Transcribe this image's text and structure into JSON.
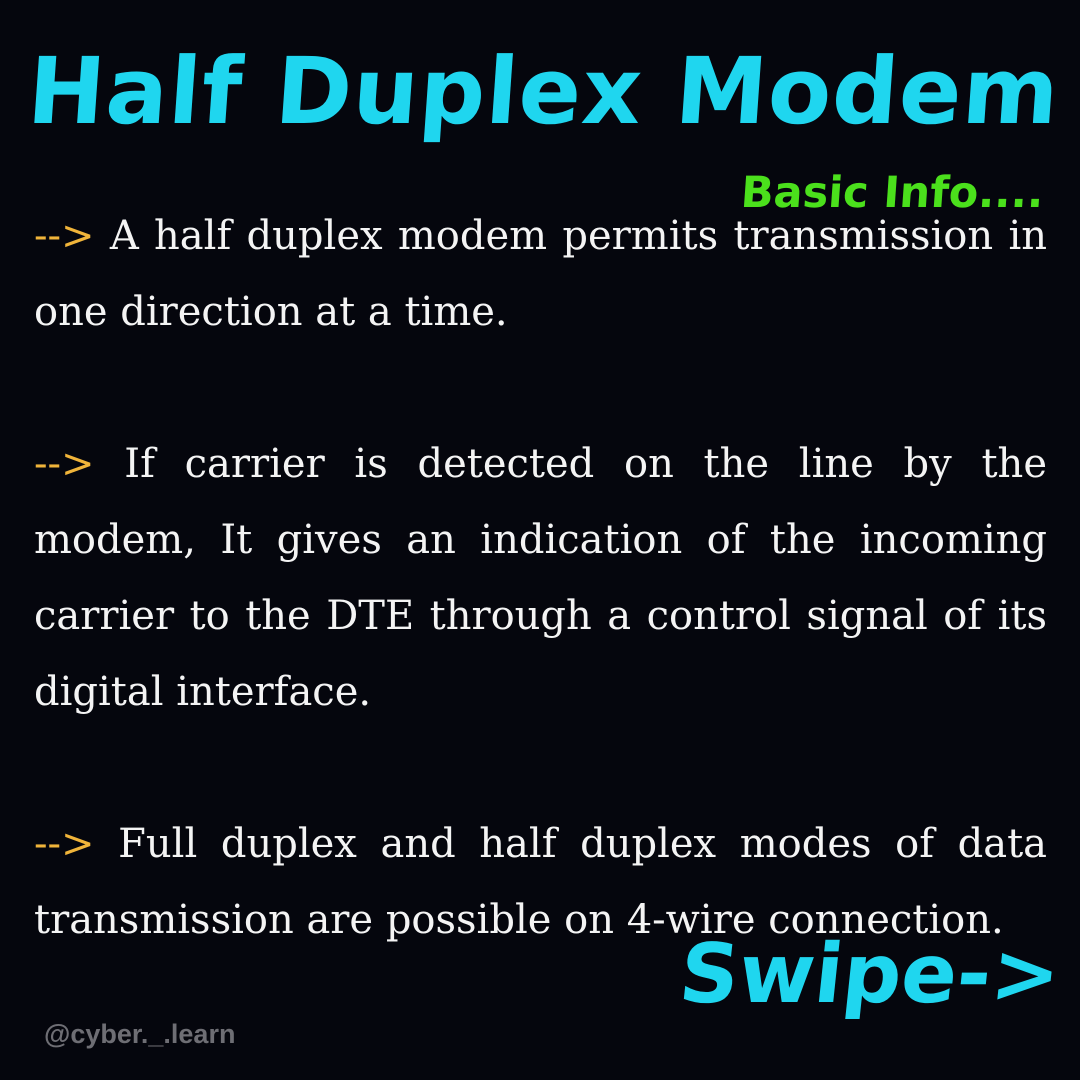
{
  "header": {
    "title": "Half Duplex Modem",
    "subtitle": "Basic Info...."
  },
  "body": {
    "paragraphs": [
      {
        "arrow": "-->",
        "text": "A half duplex modem permits transmission in one direction at a time."
      },
      {
        "arrow": "-->",
        "text": "If carrier is detected on the line by the modem, It gives an indication of the incoming carrier to the DTE through a control signal of its digital interface."
      },
      {
        "arrow": "-->",
        "text": "Full duplex and half duplex modes of data transmission are possible on 4-wire connection."
      }
    ]
  },
  "footer": {
    "swipe_label": "Swipe->",
    "handle": "@cyber._.learn"
  },
  "colors": {
    "background": "#05060d",
    "title": "#1fd6ef",
    "subtitle": "#4be01c",
    "arrow": "#f0b43a",
    "body_text": "#f4f4f4",
    "handle": "#6e6e74"
  }
}
